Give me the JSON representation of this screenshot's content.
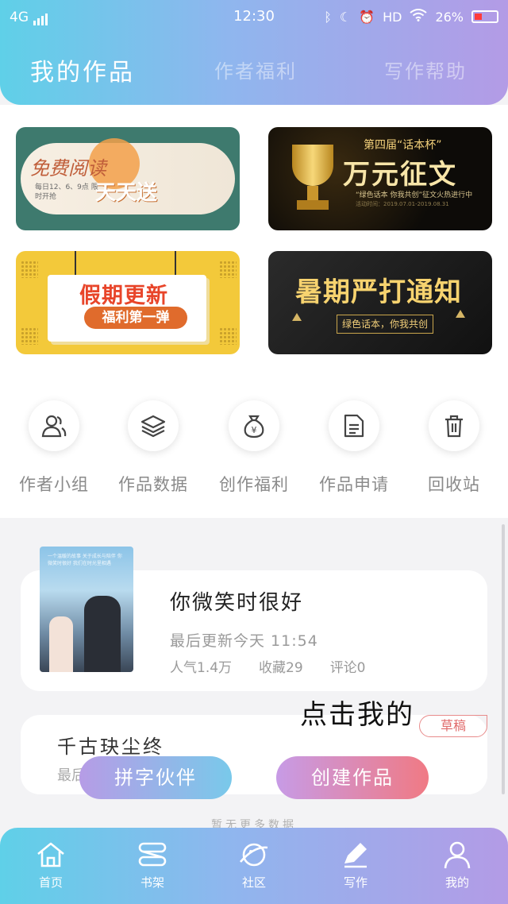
{
  "status": {
    "network": "4G",
    "time": "12:30",
    "hd": "HD",
    "battery": "26%"
  },
  "tabs": [
    "我的作品",
    "作者福利",
    "写作帮助"
  ],
  "banners": {
    "b1": {
      "title": "免费阅读",
      "subtitle": "天天送",
      "note": "每日12、6、9点 限时开抢"
    },
    "b2": {
      "top": "第四届“话本杯”",
      "title": "万元征文",
      "sub": "“绿色话本 你我共创”征文火热进行中",
      "fine": "活动时间：2019.07.01-2019.08.31"
    },
    "b3": {
      "title": "假期更新",
      "sub": "福利第一弹"
    },
    "b4": {
      "title": "暑期严打通知",
      "sub": "绿色话本，你我共创"
    }
  },
  "functions": [
    {
      "label": "作者小组",
      "icon": "users-icon"
    },
    {
      "label": "作品数据",
      "icon": "layers-icon"
    },
    {
      "label": "创作福利",
      "icon": "money-bag-icon"
    },
    {
      "label": "作品申请",
      "icon": "document-icon"
    },
    {
      "label": "回收站",
      "icon": "trash-icon"
    }
  ],
  "works": [
    {
      "title": "你微笑时很好",
      "updated": "最后更新今天 11:54",
      "popularity": "人气1.4万",
      "favorites": "收藏29",
      "comments": "评论0",
      "cover_text": "一个温暖的故事 关于成长与陪伴 你微笑时很好 我们在时光里相遇"
    },
    {
      "title": "千古玦尘终",
      "updated": "最后",
      "badge": "草稿"
    }
  ],
  "annotation": "点击我的",
  "buttons": {
    "partner": "拼字伙伴",
    "create": "创建作品"
  },
  "no_more": "暂无更多数据",
  "nav": [
    {
      "label": "首页",
      "icon": "home-icon"
    },
    {
      "label": "书架",
      "icon": "bookshelf-icon"
    },
    {
      "label": "社区",
      "icon": "planet-icon"
    },
    {
      "label": "写作",
      "icon": "pen-icon"
    },
    {
      "label": "我的",
      "icon": "user-icon"
    }
  ],
  "colors": {
    "header_start": "#5fd0e8",
    "header_end": "#b39be6",
    "draft": "#e06a6a"
  }
}
